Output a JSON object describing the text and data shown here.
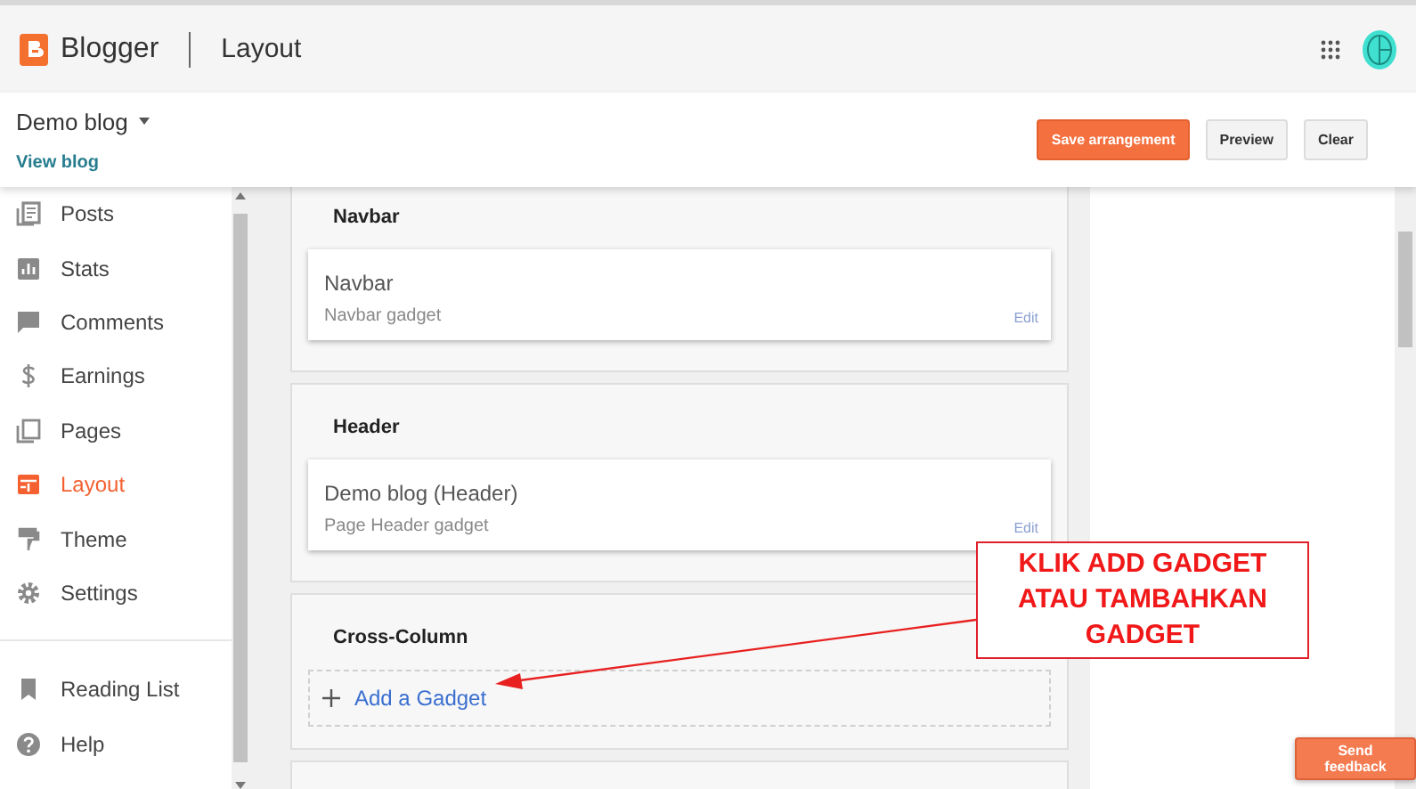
{
  "app": {
    "name": "Blogger",
    "page": "Layout"
  },
  "blog": {
    "name": "Demo blog",
    "view_link": "View blog"
  },
  "actions": [
    {
      "label": "Save arrangement",
      "kind": "primary"
    },
    {
      "label": "Preview",
      "kind": "secondary"
    },
    {
      "label": "Clear",
      "kind": "secondary"
    }
  ],
  "sidebar": {
    "items": [
      {
        "label": "Posts",
        "selected": false
      },
      {
        "label": "Stats",
        "selected": false
      },
      {
        "label": "Comments",
        "selected": false
      },
      {
        "label": "Earnings",
        "selected": false
      },
      {
        "label": "Pages",
        "selected": false
      },
      {
        "label": "Layout",
        "selected": true
      },
      {
        "label": "Theme",
        "selected": false
      },
      {
        "label": "Settings",
        "selected": false
      }
    ],
    "footer_items": [
      {
        "label": "Reading List"
      },
      {
        "label": "Help"
      }
    ]
  },
  "sections": [
    {
      "title": "Navbar",
      "gadgets": [
        {
          "name": "Navbar",
          "type": "Navbar gadget",
          "edit": "Edit"
        }
      ]
    },
    {
      "title": "Header",
      "gadgets": [
        {
          "name": "Demo blog (Header)",
          "type": "Page Header gadget",
          "edit": "Edit"
        }
      ]
    },
    {
      "title": "Cross-Column",
      "add_link": "Add a Gadget"
    }
  ],
  "annotation": {
    "text": "KLIK ADD GADGET ATAU TAMBAHKAN GADGET"
  },
  "feedback_button": "Send feedback"
}
